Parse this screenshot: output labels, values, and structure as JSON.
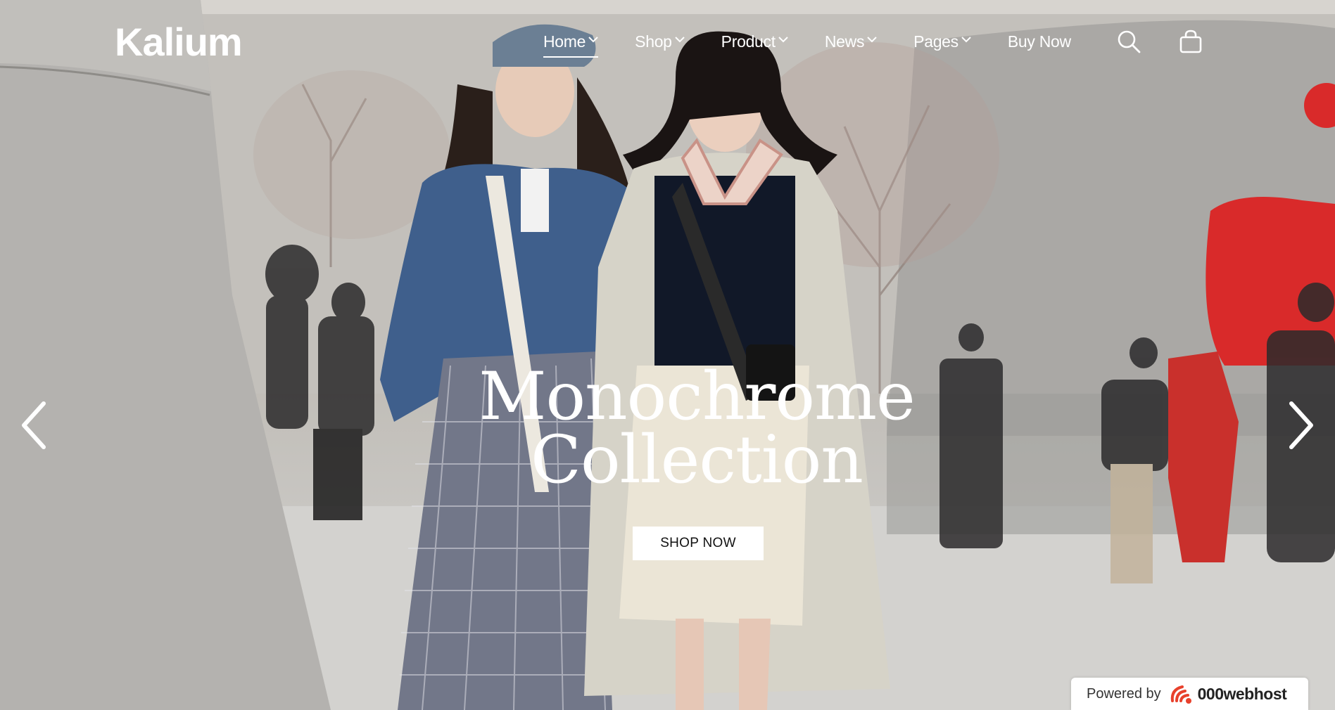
{
  "brand": {
    "logo_text": "Kalium"
  },
  "nav": {
    "items": [
      {
        "label": "Home",
        "has_dropdown": true,
        "active": true
      },
      {
        "label": "Shop",
        "has_dropdown": true,
        "active": false
      },
      {
        "label": "Product",
        "has_dropdown": true,
        "active": false
      },
      {
        "label": "News",
        "has_dropdown": true,
        "active": false
      },
      {
        "label": "Pages",
        "has_dropdown": true,
        "active": false
      },
      {
        "label": "Buy Now",
        "has_dropdown": false,
        "active": false
      }
    ],
    "icons": [
      "search-icon",
      "shopping-bag-icon"
    ]
  },
  "slider": {
    "headline_line1": "Monochrome",
    "headline_line2": "Collection",
    "cta_label": "SHOP NOW",
    "prev_icon": "chevron-left-icon",
    "next_icon": "chevron-right-icon"
  },
  "footer_badge": {
    "prefix": "Powered by",
    "brand": "000webhost"
  },
  "colors": {
    "text_on_hero": "#ffffff",
    "button_bg": "#ffffff",
    "button_text": "#111111",
    "badge_logo": "#e8412c"
  }
}
